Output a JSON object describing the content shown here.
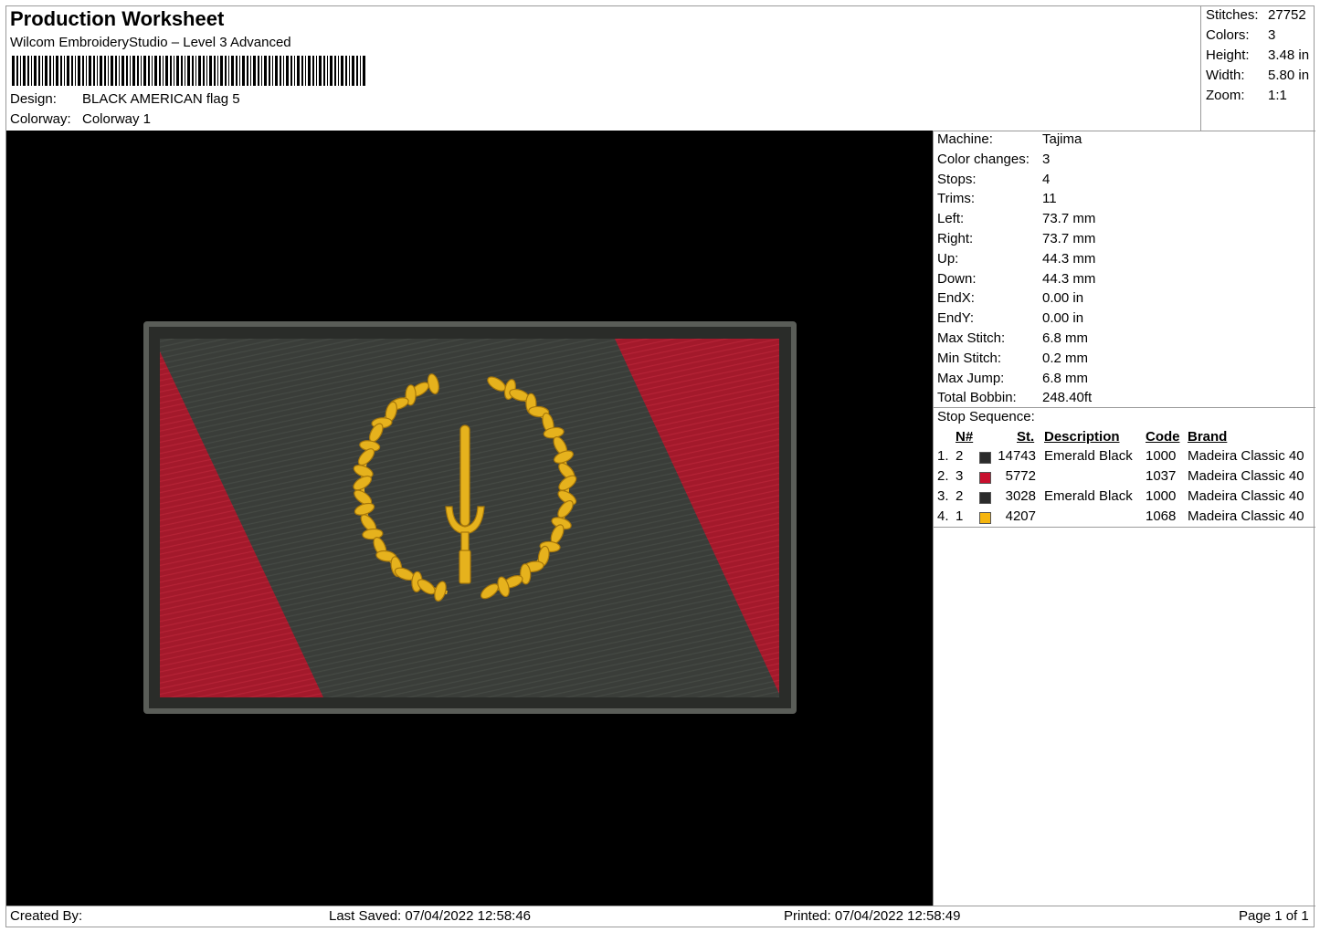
{
  "header": {
    "title": "Production Worksheet",
    "subtitle": "Wilcom EmbroideryStudio – Level 3 Advanced",
    "design_label": "Design:",
    "design_value": "BLACK AMERICAN flag 5",
    "colorway_label": "Colorway:",
    "colorway_value": "Colorway 1"
  },
  "summary": [
    {
      "label": "Stitches:",
      "value": "27752"
    },
    {
      "label": "Colors:",
      "value": "3"
    },
    {
      "label": "Height:",
      "value": "3.48 in"
    },
    {
      "label": "Width:",
      "value": "5.80 in"
    },
    {
      "label": "Zoom:",
      "value": "1:1"
    }
  ],
  "properties": [
    {
      "label": "Machine:",
      "value": "Tajima"
    },
    {
      "label": "Color changes:",
      "value": "3"
    },
    {
      "label": "Stops:",
      "value": "4"
    },
    {
      "label": "Trims:",
      "value": "11"
    },
    {
      "label": "Left:",
      "value": "73.7 mm"
    },
    {
      "label": "Right:",
      "value": "73.7 mm"
    },
    {
      "label": "Up:",
      "value": "44.3 mm"
    },
    {
      "label": "Down:",
      "value": "44.3 mm"
    },
    {
      "label": "EndX:",
      "value": "0.00 in"
    },
    {
      "label": "EndY:",
      "value": "0.00 in"
    },
    {
      "label": "Max Stitch:",
      "value": "6.8 mm"
    },
    {
      "label": "Min Stitch:",
      "value": "0.2 mm"
    },
    {
      "label": "Max Jump:",
      "value": "6.8 mm"
    },
    {
      "label": "Total Bobbin:",
      "value": "248.40ft"
    }
  ],
  "stop_sequence": {
    "title": "Stop Sequence:",
    "headers": {
      "n": "N#",
      "st": "St.",
      "description": "Description",
      "code": "Code",
      "brand": "Brand"
    },
    "rows": [
      {
        "index": "1.",
        "n": "2",
        "color": "#2b2b2b",
        "st": "14743",
        "description": "Emerald Black",
        "code": "1000",
        "brand": "Madeira Classic 40"
      },
      {
        "index": "2.",
        "n": "3",
        "color": "#c8102e",
        "st": "5772",
        "description": "",
        "code": "1037",
        "brand": "Madeira Classic 40"
      },
      {
        "index": "3.",
        "n": "2",
        "color": "#2b2b2b",
        "st": "3028",
        "description": "Emerald Black",
        "code": "1000",
        "brand": "Madeira Classic 40"
      },
      {
        "index": "4.",
        "n": "1",
        "color": "#f5b50f",
        "st": "4207",
        "description": "",
        "code": "1068",
        "brand": "Madeira Classic 40"
      }
    ]
  },
  "footer": {
    "created_by": "Created By:",
    "last_saved": "Last Saved: 07/04/2022 12:58:46",
    "printed": "Printed: 07/04/2022 12:58:49",
    "page": "Page 1 of 1"
  },
  "colors": {
    "flag_dark": "#3a3d39",
    "flag_red": "#a3192b",
    "emblem_gold": "#e6b21d",
    "preview_bg": "#000000"
  }
}
